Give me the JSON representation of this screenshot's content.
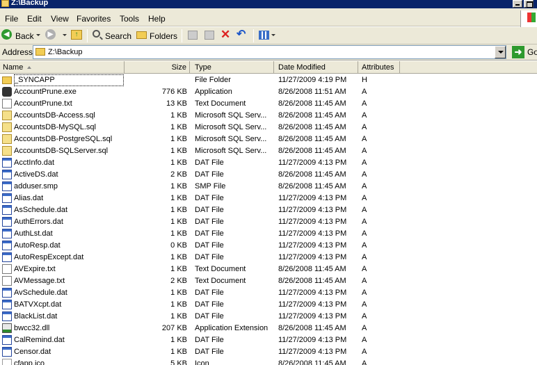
{
  "window": {
    "title": "Z:\\Backup"
  },
  "menu": [
    {
      "label": "File"
    },
    {
      "label": "Edit"
    },
    {
      "label": "View"
    },
    {
      "label": "Favorites"
    },
    {
      "label": "Tools"
    },
    {
      "label": "Help"
    }
  ],
  "toolbar": {
    "back_label": "Back",
    "search_label": "Search",
    "folders_label": "Folders"
  },
  "address": {
    "label": "Address",
    "value": "Z:\\Backup",
    "go_label": "Go"
  },
  "columns": {
    "name": "Name",
    "size": "Size",
    "type": "Type",
    "date": "Date Modified",
    "attributes": "Attributes"
  },
  "files": [
    {
      "name": "_SYNCAPP",
      "size": "",
      "type": "File Folder",
      "date": "11/27/2009 4:19 PM",
      "attr": "H",
      "icon": "folder-icon"
    },
    {
      "name": "AccountPrune.exe",
      "size": "776 KB",
      "type": "Application",
      "date": "8/26/2008 11:51 AM",
      "attr": "A",
      "icon": "exe-icon"
    },
    {
      "name": "AccountPrune.txt",
      "size": "13 KB",
      "type": "Text Document",
      "date": "8/26/2008 11:45 AM",
      "attr": "A",
      "icon": "text-file-icon"
    },
    {
      "name": "AccountsDB-Access.sql",
      "size": "1 KB",
      "type": "Microsoft SQL Serv...",
      "date": "8/26/2008 11:45 AM",
      "attr": "A",
      "icon": "sql-file-icon"
    },
    {
      "name": "AccountsDB-MySQL.sql",
      "size": "1 KB",
      "type": "Microsoft SQL Serv...",
      "date": "8/26/2008 11:45 AM",
      "attr": "A",
      "icon": "sql-file-icon"
    },
    {
      "name": "AccountsDB-PostgreSQL.sql",
      "size": "1 KB",
      "type": "Microsoft SQL Serv...",
      "date": "8/26/2008 11:45 AM",
      "attr": "A",
      "icon": "sql-file-icon"
    },
    {
      "name": "AccountsDB-SQLServer.sql",
      "size": "1 KB",
      "type": "Microsoft SQL Serv...",
      "date": "8/26/2008 11:45 AM",
      "attr": "A",
      "icon": "sql-file-icon"
    },
    {
      "name": "AcctInfo.dat",
      "size": "1 KB",
      "type": "DAT File",
      "date": "11/27/2009 4:13 PM",
      "attr": "A",
      "icon": "dat-file-icon"
    },
    {
      "name": "ActiveDS.dat",
      "size": "2 KB",
      "type": "DAT File",
      "date": "8/26/2008 11:45 AM",
      "attr": "A",
      "icon": "dat-file-icon"
    },
    {
      "name": "adduser.smp",
      "size": "1 KB",
      "type": "SMP File",
      "date": "8/26/2008 11:45 AM",
      "attr": "A",
      "icon": "smp-file-icon"
    },
    {
      "name": "Alias.dat",
      "size": "1 KB",
      "type": "DAT File",
      "date": "11/27/2009 4:13 PM",
      "attr": "A",
      "icon": "dat-file-icon"
    },
    {
      "name": "AsSchedule.dat",
      "size": "1 KB",
      "type": "DAT File",
      "date": "11/27/2009 4:13 PM",
      "attr": "A",
      "icon": "dat-file-icon"
    },
    {
      "name": "AuthErrors.dat",
      "size": "1 KB",
      "type": "DAT File",
      "date": "11/27/2009 4:13 PM",
      "attr": "A",
      "icon": "dat-file-icon"
    },
    {
      "name": "AuthLst.dat",
      "size": "1 KB",
      "type": "DAT File",
      "date": "11/27/2009 4:13 PM",
      "attr": "A",
      "icon": "dat-file-icon"
    },
    {
      "name": "AutoResp.dat",
      "size": "0 KB",
      "type": "DAT File",
      "date": "11/27/2009 4:13 PM",
      "attr": "A",
      "icon": "dat-file-icon"
    },
    {
      "name": "AutoRespExcept.dat",
      "size": "1 KB",
      "type": "DAT File",
      "date": "11/27/2009 4:13 PM",
      "attr": "A",
      "icon": "dat-file-icon"
    },
    {
      "name": "AVExpire.txt",
      "size": "1 KB",
      "type": "Text Document",
      "date": "8/26/2008 11:45 AM",
      "attr": "A",
      "icon": "text-file-icon"
    },
    {
      "name": "AVMessage.txt",
      "size": "2 KB",
      "type": "Text Document",
      "date": "8/26/2008 11:45 AM",
      "attr": "A",
      "icon": "text-file-icon"
    },
    {
      "name": "AvSchedule.dat",
      "size": "1 KB",
      "type": "DAT File",
      "date": "11/27/2009 4:13 PM",
      "attr": "A",
      "icon": "dat-file-icon"
    },
    {
      "name": "BATVXcpt.dat",
      "size": "1 KB",
      "type": "DAT File",
      "date": "11/27/2009 4:13 PM",
      "attr": "A",
      "icon": "dat-file-icon"
    },
    {
      "name": "BlackList.dat",
      "size": "1 KB",
      "type": "DAT File",
      "date": "11/27/2009 4:13 PM",
      "attr": "A",
      "icon": "dat-file-icon"
    },
    {
      "name": "bwcc32.dll",
      "size": "207 KB",
      "type": "Application Extension",
      "date": "8/26/2008 11:45 AM",
      "attr": "A",
      "icon": "dll-file-icon"
    },
    {
      "name": "CalRemind.dat",
      "size": "1 KB",
      "type": "DAT File",
      "date": "11/27/2009 4:13 PM",
      "attr": "A",
      "icon": "dat-file-icon"
    },
    {
      "name": "Censor.dat",
      "size": "1 KB",
      "type": "DAT File",
      "date": "11/27/2009 4:13 PM",
      "attr": "A",
      "icon": "dat-file-icon"
    },
    {
      "name": "cfapp.ico",
      "size": "5 KB",
      "type": "Icon",
      "date": "8/26/2008 11:45 AM",
      "attr": "A",
      "icon": "ico-file-icon"
    }
  ]
}
